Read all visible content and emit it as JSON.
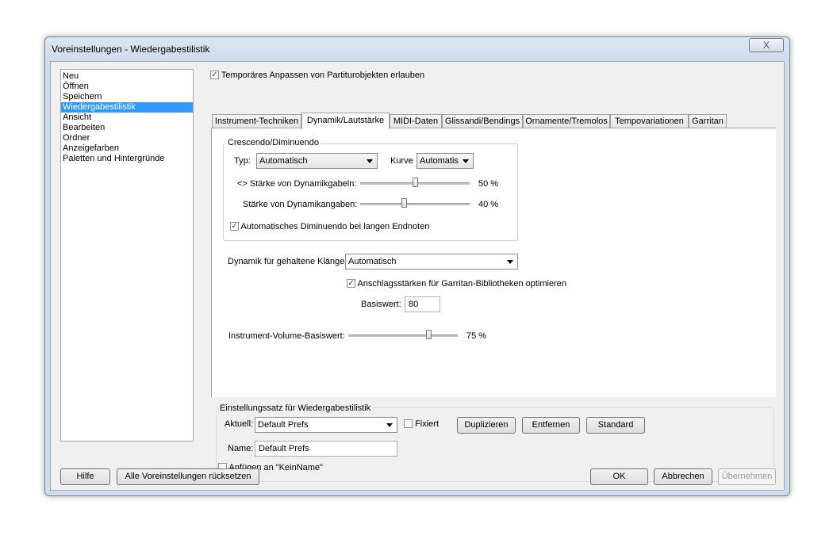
{
  "window": {
    "title": "Voreinstellungen - Wiedergabestilistik",
    "close_label": "X"
  },
  "sidebar": {
    "items": [
      {
        "label": "Neu",
        "selected": false
      },
      {
        "label": "Öffnen",
        "selected": false
      },
      {
        "label": "Speichern",
        "selected": false
      },
      {
        "label": "Wiedergabestilistik",
        "selected": true
      },
      {
        "label": "Ansicht",
        "selected": false
      },
      {
        "label": "Bearbeiten",
        "selected": false
      },
      {
        "label": "Ordner",
        "selected": false
      },
      {
        "label": "Anzeigefarben",
        "selected": false
      },
      {
        "label": "Paletten und Hintergründe",
        "selected": false
      }
    ]
  },
  "top_checkbox": {
    "label": "Temporäres Anpassen von Partiturobjekten erlauben",
    "checked": true
  },
  "tabs": [
    {
      "label": "Instrument-Techniken",
      "active": false
    },
    {
      "label": "Dynamik/Lautstärke",
      "active": true
    },
    {
      "label": "MIDI-Daten",
      "active": false
    },
    {
      "label": "Glissandi/Bendings",
      "active": false
    },
    {
      "label": "Ornamente/Tremolos",
      "active": false
    },
    {
      "label": "Tempovariationen",
      "active": false
    },
    {
      "label": "Garritan",
      "active": false
    }
  ],
  "crescendo": {
    "group_label": "Crescendo/Diminuendo",
    "typ_label": "Typ:",
    "typ_value": "Automatisch",
    "kurve_label": "Kurve",
    "kurve_value": "Automatis",
    "gabeln_label": "<> Stärke von Dynamikgabeln:",
    "gabeln_value": "50 %",
    "gabeln_level": 0.5,
    "angaben_label": "Stärke von Dynamikangaben:",
    "angaben_value": "40 %",
    "angaben_level": 0.4,
    "auto_dim_label": "Automatisches Diminuendo bei langen Endnoten",
    "auto_dim_checked": true
  },
  "dynamik_gehalten": {
    "label": "Dynamik für gehaltene Klänge:",
    "value": "Automatisch"
  },
  "garritan_opt": {
    "label": "Anschlagsstärken für Garritan-Bibliotheken optimieren",
    "checked": true
  },
  "basiswert": {
    "label": "Basiswert:",
    "value": "80"
  },
  "instrument_volume": {
    "label": "Instrument-Volume-Basiswert:",
    "value": "75 %",
    "level": 0.75
  },
  "settings_set": {
    "group_label": "Einstellungssatz für Wiedergabestilistik",
    "aktuell_label": "Aktuell:",
    "aktuell_value": "Default Prefs",
    "fixiert_label": "Fixiert",
    "fixiert_checked": false,
    "duplizieren": "Duplizieren",
    "entfernen": "Entfernen",
    "standard": "Standard",
    "name_label": "Name:",
    "name_value": "Default Prefs",
    "anfuegen_label": "Anfügen an \"KeinName\"",
    "anfuegen_checked": false
  },
  "bottom_buttons": {
    "hilfe": "Hilfe",
    "reset": "Alle Voreinstellungen rücksetzen",
    "ok": "OK",
    "abbrechen": "Abbrechen",
    "uebernehmen": "Übernehmen"
  }
}
